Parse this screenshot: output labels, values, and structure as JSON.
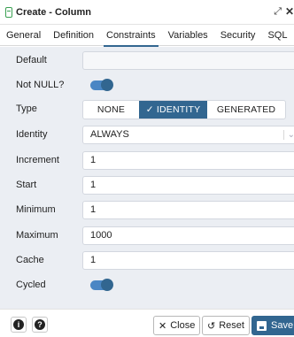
{
  "window": {
    "title": "Create - Column"
  },
  "tabs": [
    {
      "label": "General"
    },
    {
      "label": "Definition"
    },
    {
      "label": "Constraints"
    },
    {
      "label": "Variables"
    },
    {
      "label": "Security"
    },
    {
      "label": "SQL"
    }
  ],
  "active_tab": "Constraints",
  "form": {
    "default": {
      "label": "Default",
      "value": ""
    },
    "not_null": {
      "label": "Not NULL?",
      "on": true
    },
    "type": {
      "label": "Type",
      "options": [
        "NONE",
        "IDENTITY",
        "GENERATED"
      ],
      "selected": "IDENTITY"
    },
    "identity": {
      "label": "Identity",
      "value": "ALWAYS"
    },
    "increment": {
      "label": "Increment",
      "value": "1"
    },
    "start": {
      "label": "Start",
      "value": "1"
    },
    "minimum": {
      "label": "Minimum",
      "value": "1"
    },
    "maximum": {
      "label": "Maximum",
      "value": "1000"
    },
    "cache": {
      "label": "Cache",
      "value": "1"
    },
    "cycled": {
      "label": "Cycled",
      "on": true
    }
  },
  "footer": {
    "info_glyph": "i",
    "help_glyph": "?",
    "close_label": "Close",
    "reset_label": "Reset",
    "save_label": "Save"
  },
  "colors": {
    "accent": "#326690",
    "panel_bg": "#ebeef3",
    "toggle_track": "#4a86c4"
  }
}
